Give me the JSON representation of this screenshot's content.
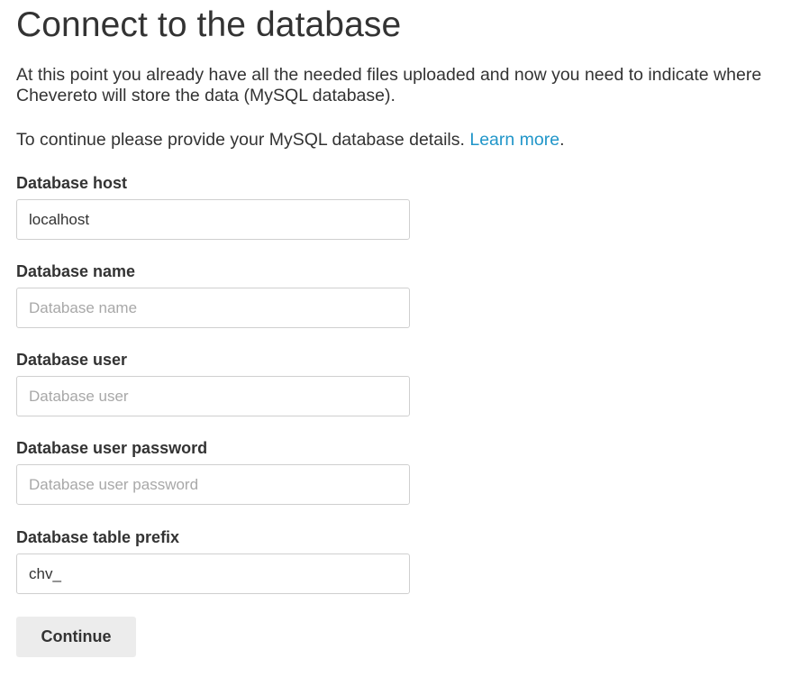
{
  "page": {
    "title": "Connect to the database",
    "intro": "At this point you already have all the needed files uploaded and now you need to indicate where Chevereto will store the data (MySQL database).",
    "continue_prefix": "To continue please provide your MySQL database details.",
    "learn_more_link": "Learn more",
    "continue_suffix": "."
  },
  "form": {
    "host": {
      "label": "Database host",
      "value": "localhost",
      "placeholder": ""
    },
    "name": {
      "label": "Database name",
      "value": "",
      "placeholder": "Database name"
    },
    "user": {
      "label": "Database user",
      "value": "",
      "placeholder": "Database user"
    },
    "password": {
      "label": "Database user password",
      "value": "",
      "placeholder": "Database user password"
    },
    "prefix": {
      "label": "Database table prefix",
      "value": "chv_",
      "placeholder": ""
    },
    "submit_label": "Continue"
  },
  "colors": {
    "text": "#333333",
    "link": "#2196c9",
    "placeholder": "#a8a8a8",
    "input_border": "#cfcfcf",
    "button_bg": "#ececec"
  }
}
